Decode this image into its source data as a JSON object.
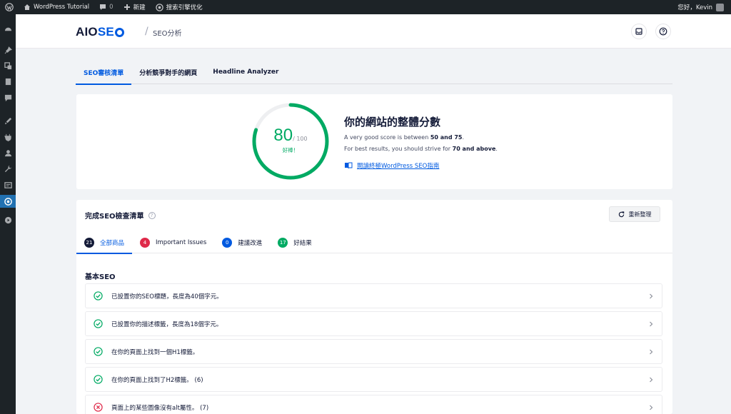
{
  "adminbar": {
    "site_name": "WordPress Tutorial",
    "comments_count": "0",
    "new_label": "新建",
    "seo_label": "搜索引擎优化",
    "greeting": "您好，Kevin"
  },
  "header": {
    "logo_aio": "AIO",
    "logo_seo": "SE",
    "page_name": "SEO分析"
  },
  "tabs": [
    {
      "label": "SEO審核清單",
      "active": true
    },
    {
      "label": "分析競爭對手的網頁",
      "active": false
    },
    {
      "label": "Headline Analyzer",
      "active": false
    }
  ],
  "score": {
    "value": 80,
    "value_text": "80",
    "out_of": "/ 100",
    "label": "好棒！",
    "title": "你的網站的整體分數",
    "line1_prefix": "A very good score is between ",
    "line1_bold": "50 and 75",
    "line1_suffix": ".",
    "line2_prefix": "For best results, you should strive for ",
    "line2_bold": "70 and above",
    "line2_suffix": ".",
    "guide_link": "閱讀終極WordPress SEO指南",
    "color": "#00aa63"
  },
  "checklist": {
    "title": "完成SEO檢查清單",
    "refresh_label": "重新整理",
    "filters": [
      {
        "count": "21",
        "label": "全部商品",
        "color": "#141b38",
        "active": true
      },
      {
        "count": "4",
        "label": "Important Issues",
        "color": "#df2a4a",
        "active": false
      },
      {
        "count": "0",
        "label": "建議改進",
        "color": "#005ae0",
        "active": false
      },
      {
        "count": "17",
        "label": "好結果",
        "color": "#00aa63",
        "active": false
      }
    ],
    "section_title": "基本SEO",
    "items": [
      {
        "text": "已設置你的SEO標題，長度為40個字元。",
        "status": "pass"
      },
      {
        "text": "已設置你的描述標籤，長度為18個字元。",
        "status": "pass"
      },
      {
        "text": "在你的頁面上找到一個H1標籤。",
        "status": "pass"
      },
      {
        "text": "在你的頁面上找到了H2標籤。 (6)",
        "status": "pass"
      },
      {
        "text": "頁面上的某些圖像沒有alt屬性。 (7)",
        "status": "fail"
      }
    ]
  },
  "colors": {
    "accent": "#005ae0",
    "success": "#00aa63",
    "error": "#df2a4a",
    "wp_dark": "#1d2327"
  }
}
